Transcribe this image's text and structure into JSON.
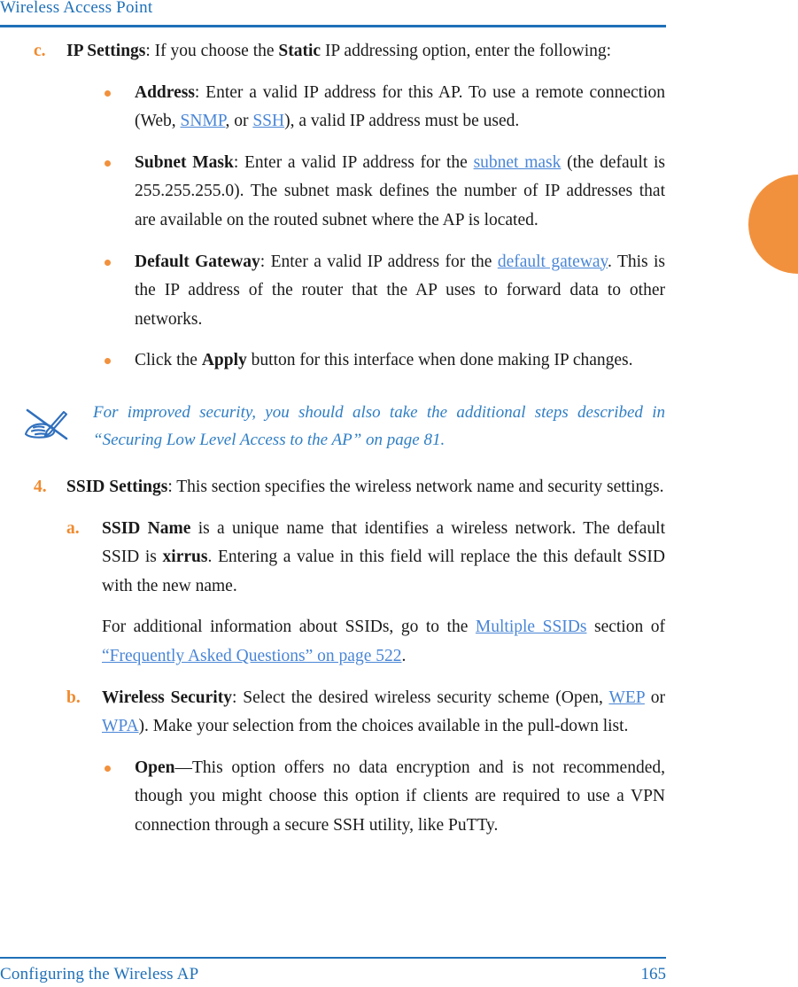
{
  "header": {
    "running_head": "Wireless Access Point"
  },
  "footer": {
    "section_title": "Configuring the Wireless AP",
    "page_number": "165"
  },
  "colors": {
    "header_blue": "#1f70b8",
    "link_blue": "#4a86d6",
    "note_blue": "#2f7ec4",
    "marker_orange": "#f08a2e",
    "bullet_orange": "#f2913d",
    "thumb_tab_orange": "#f2913d"
  },
  "thumb_tab": {
    "shape": "half-circle",
    "side": "right"
  },
  "body": {
    "item_c": {
      "marker": "c.",
      "lead": "IP Settings",
      "text_after_lead": ": If you choose the ",
      "bold_static": "Static",
      "text_tail": " IP addressing option, enter the following:"
    },
    "bullet_address": {
      "lead": "Address",
      "seg1": ": Enter a valid IP address for this AP. To use a remote connection (Web, ",
      "link1": "SNMP",
      "seg2": ", or ",
      "link2": "SSH",
      "seg3": "), a valid IP address must be used."
    },
    "bullet_subnet": {
      "lead": "Subnet Mask",
      "seg1": ": Enter a valid IP address for the ",
      "link1": "subnet mask",
      "seg2": " (the default is 255.255.255.0). The subnet mask defines the number of IP addresses that are available on the routed subnet where the AP is located."
    },
    "bullet_gateway": {
      "lead": "Default Gateway",
      "seg1": ": Enter a valid IP address for the ",
      "link1": "default gateway",
      "seg2": ". This is the IP address of the router that the AP uses to forward data to other networks."
    },
    "bullet_apply": {
      "seg1": "Click the ",
      "bold1": "Apply",
      "seg2": " button for this interface when done making IP changes."
    },
    "note": {
      "icon": "hand-with-pencil-note-icon",
      "line1": "For improved security, you should also take the additional steps described in",
      "line2": "“Securing Low Level Access to the AP” on page 81."
    },
    "item_4": {
      "marker": "4.",
      "lead": "SSID Settings",
      "seg1": ": This section specifies the wireless network name and security settings."
    },
    "item_4a": {
      "marker": "a.",
      "lead": "SSID Name",
      "seg1": " is a unique name that identifies a wireless network. The default SSID is ",
      "bold1": "xirrus",
      "seg2": ". Entering a value in this field will replace the this default SSID with the new name."
    },
    "item_4a_para2": {
      "seg1": "For additional information about SSIDs, go to the ",
      "link1": "Multiple SSIDs",
      "seg2": " section of ",
      "link2": "“Frequently Asked Questions” on page 522",
      "seg3": "."
    },
    "item_4b": {
      "marker": "b.",
      "lead": "Wireless Security",
      "seg1": ": Select the desired wireless security scheme (Open, ",
      "link1": "WEP",
      "seg2": " or ",
      "link2": "WPA",
      "seg3": "). Make your selection from the choices available in the pull-down list."
    },
    "bullet_open": {
      "lead": "Open",
      "seg1": "—This option offers no data encryption and is not recommended, though you might choose this option if clients are required to use a VPN connection through a secure SSH utility, like PuTTy."
    }
  }
}
